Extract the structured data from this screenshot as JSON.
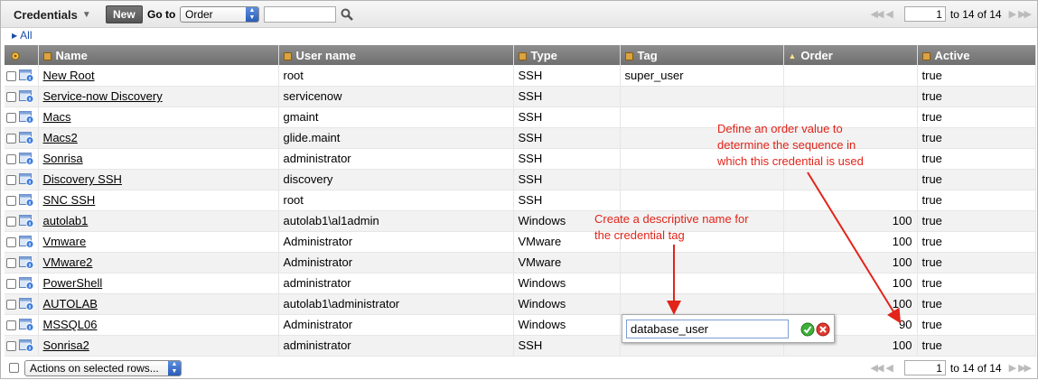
{
  "toolbar": {
    "title": "Credentials",
    "new_label": "New",
    "goto_label": "Go to",
    "goto_value": "Order",
    "search_value": "",
    "pager": {
      "page_value": "1",
      "count_text": "to 14 of 14"
    }
  },
  "breadcrumb": {
    "all_label": "All"
  },
  "table": {
    "columns": [
      "Name",
      "User name",
      "Type",
      "Tag",
      "Order",
      "Active"
    ],
    "rows": [
      {
        "name": "New Root",
        "user": "root",
        "type": "SSH",
        "tag": "super_user",
        "order": "",
        "active": "true"
      },
      {
        "name": "Service-now Discovery",
        "user": "servicenow",
        "type": "SSH",
        "tag": "",
        "order": "",
        "active": "true"
      },
      {
        "name": "Macs",
        "user": "gmaint",
        "type": "SSH",
        "tag": "",
        "order": "",
        "active": "true"
      },
      {
        "name": "Macs2",
        "user": "glide.maint",
        "type": "SSH",
        "tag": "",
        "order": "",
        "active": "true"
      },
      {
        "name": "Sonrisa",
        "user": "administrator",
        "type": "SSH",
        "tag": "",
        "order": "",
        "active": "true"
      },
      {
        "name": "Discovery SSH",
        "user": "discovery",
        "type": "SSH",
        "tag": "",
        "order": "",
        "active": "true"
      },
      {
        "name": "SNC SSH",
        "user": "root",
        "type": "SSH",
        "tag": "",
        "order": "",
        "active": "true"
      },
      {
        "name": "autolab1",
        "user": "autolab1\\al1admin",
        "type": "Windows",
        "tag": "",
        "order": "100",
        "active": "true"
      },
      {
        "name": "Vmware",
        "user": "Administrator",
        "type": "VMware",
        "tag": "",
        "order": "100",
        "active": "true"
      },
      {
        "name": "VMware2",
        "user": "Administrator",
        "type": "VMware",
        "tag": "",
        "order": "100",
        "active": "true"
      },
      {
        "name": "PowerShell",
        "user": "administrator",
        "type": "Windows",
        "tag": "",
        "order": "100",
        "active": "true"
      },
      {
        "name": "AUTOLAB",
        "user": "autolab1\\administrator",
        "type": "Windows",
        "tag": "",
        "order": "100",
        "active": "true"
      },
      {
        "name": "MSSQL06",
        "user": "Administrator",
        "type": "Windows",
        "tag": "",
        "order": "90",
        "active": "true"
      },
      {
        "name": "Sonrisa2",
        "user": "administrator",
        "type": "SSH",
        "tag": "",
        "order": "100",
        "active": "true"
      }
    ]
  },
  "editor": {
    "value": "database_user"
  },
  "annotations": {
    "order_note": "Define an order value to determine the sequence in which this credential is used",
    "tag_note": "Create a descriptive name for the credential tag"
  },
  "bottombar": {
    "actions_label": "Actions on selected rows...",
    "pager": {
      "page_value": "1",
      "count_text": "to 14 of 14"
    }
  },
  "colors": {
    "annotation": "#e2241a",
    "header": "#7f7f7f",
    "link": "#1a4ea6"
  }
}
